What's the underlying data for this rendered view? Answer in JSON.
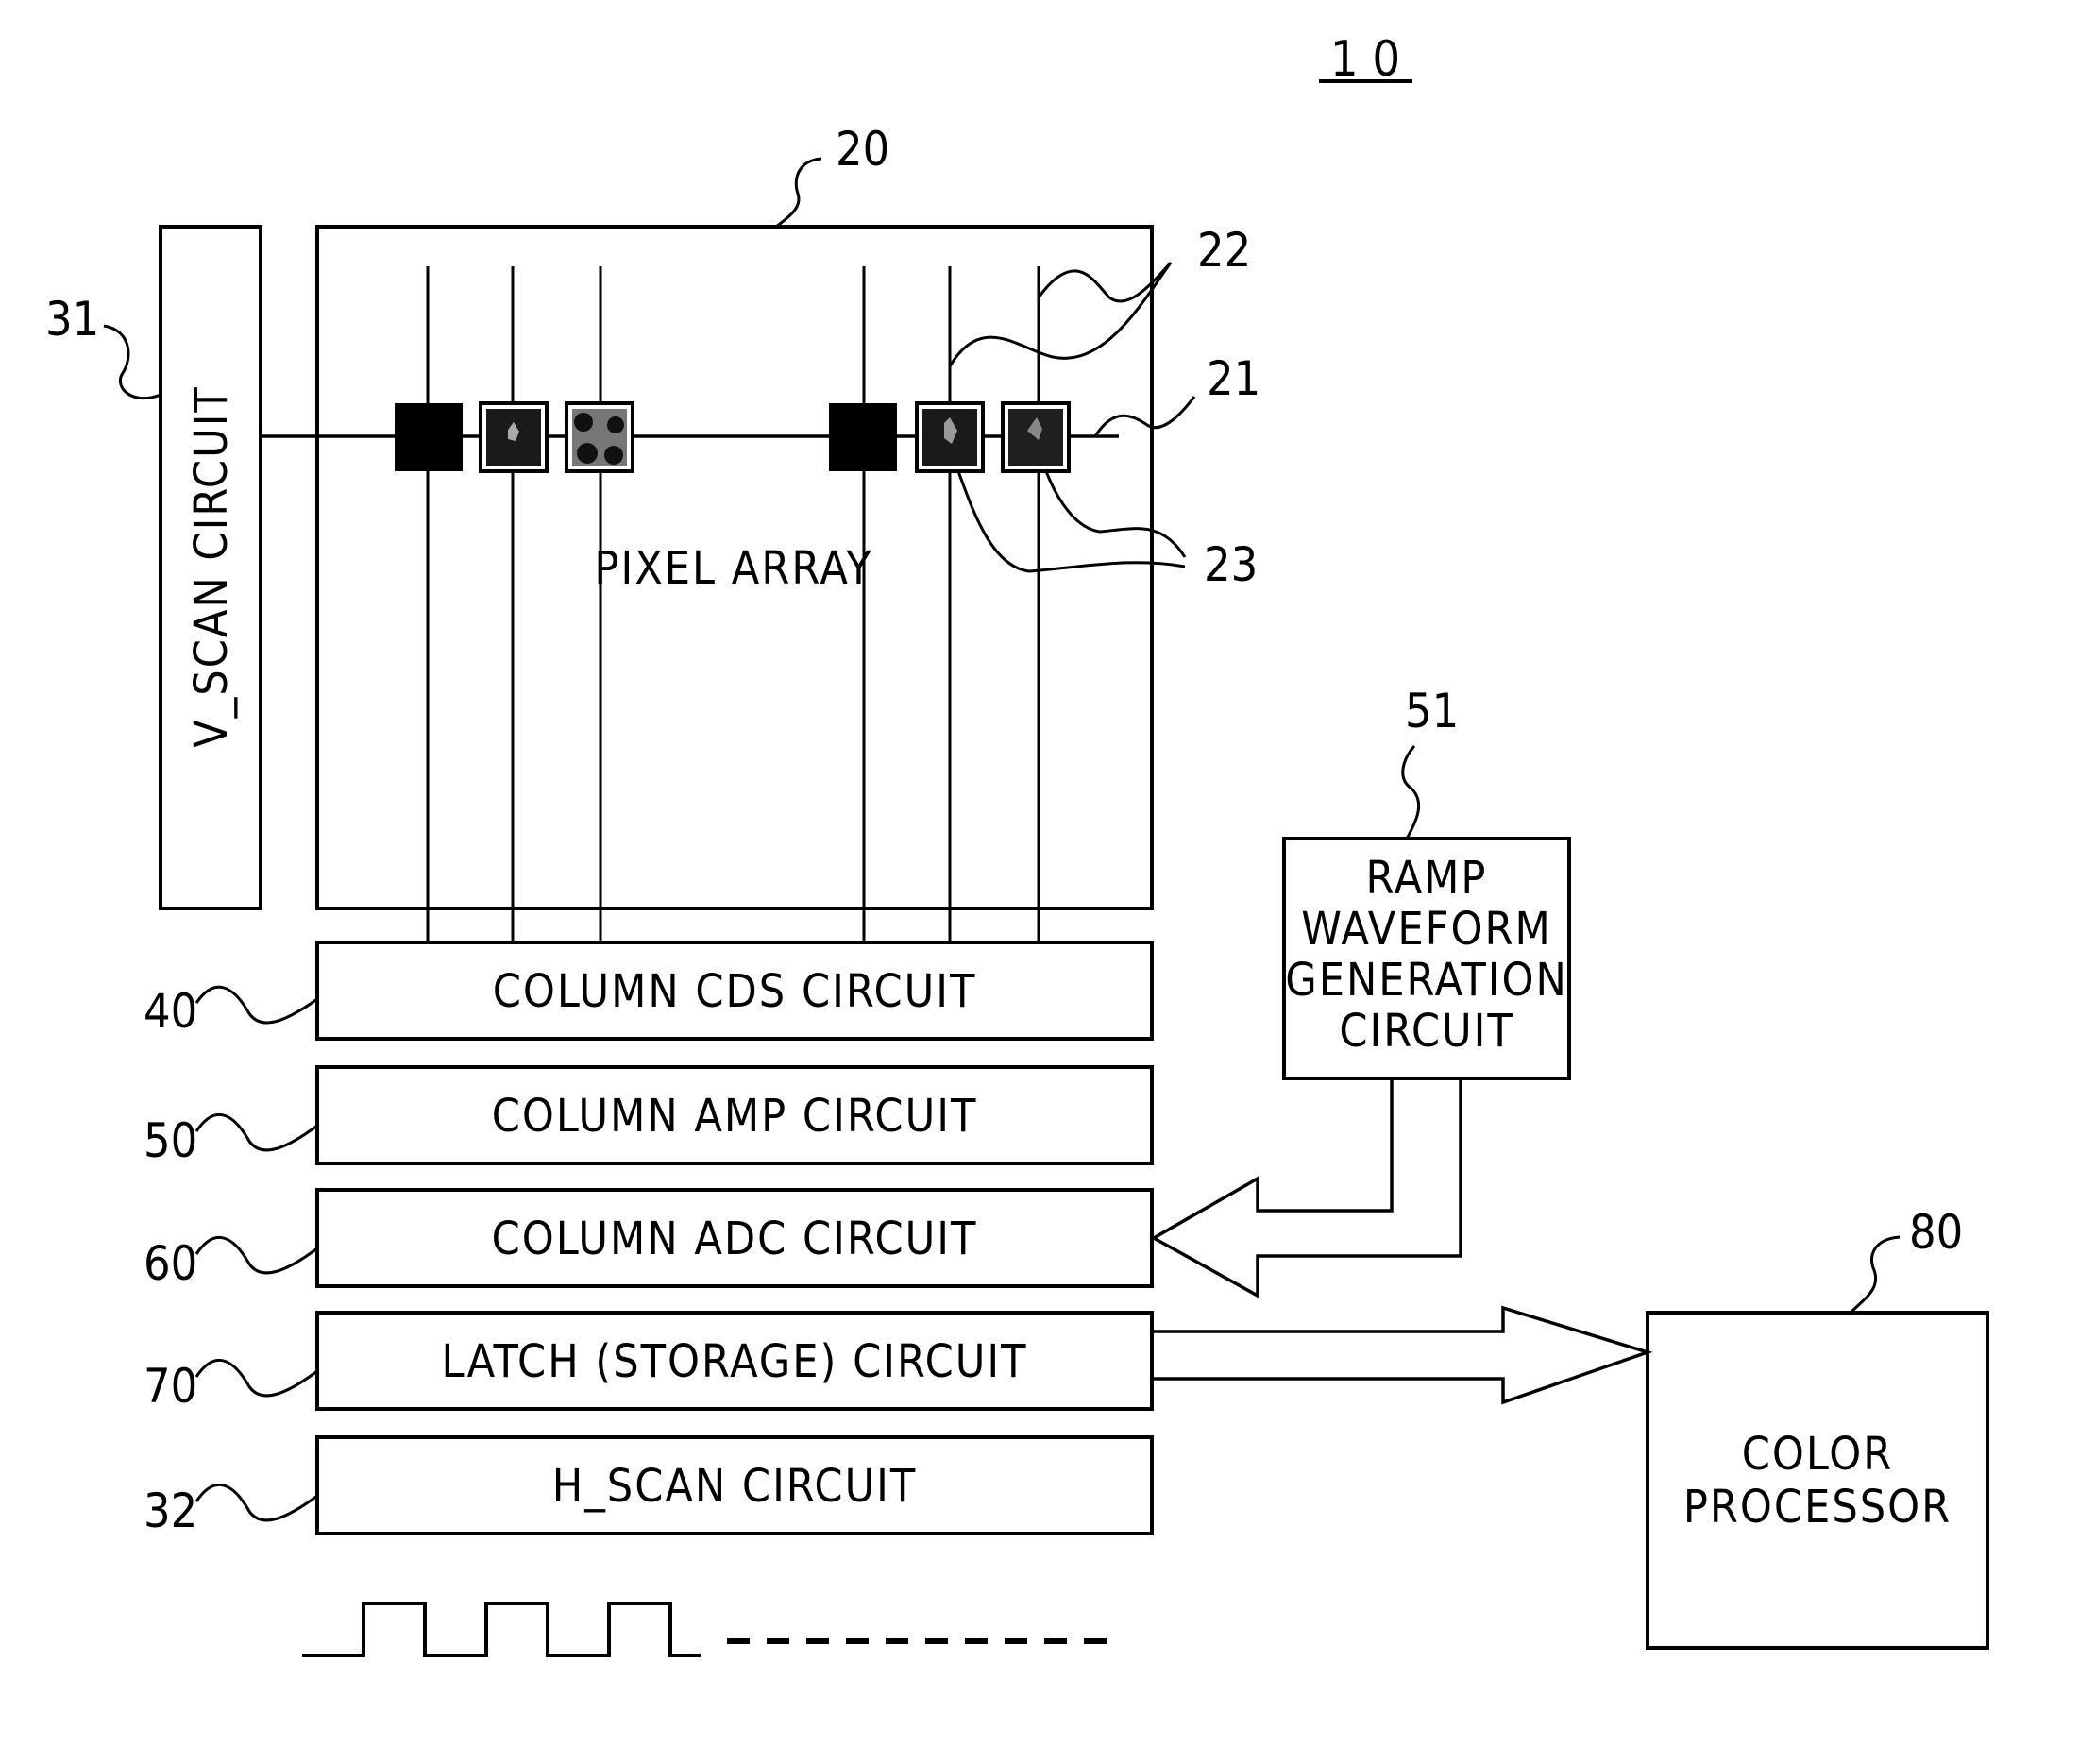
{
  "figure": {
    "number": "1 0",
    "colors": {
      "ink": "#000000",
      "paper": "#ffffff",
      "pixel_dark": "#111111",
      "pixel_mid": "#555555"
    }
  },
  "blocks": {
    "v_scan": {
      "ref": "31",
      "label": "V_SCAN CIRCUIT"
    },
    "pixel_array": {
      "ref": "20",
      "label": "PIXEL ARRAY",
      "row_line_ref": "21",
      "column_line_ref": "22",
      "pixel_ref": "23"
    },
    "cds": {
      "ref": "40",
      "label": "COLUMN CDS CIRCUIT"
    },
    "amp": {
      "ref": "50",
      "label": "COLUMN AMP CIRCUIT"
    },
    "adc": {
      "ref": "60",
      "label": "COLUMN ADC CIRCUIT"
    },
    "latch": {
      "ref": "70",
      "label": "LATCH (STORAGE) CIRCUIT"
    },
    "h_scan": {
      "ref": "32",
      "label": "H_SCAN CIRCUIT"
    },
    "ramp": {
      "ref": "51",
      "lines": [
        "RAMP",
        "WAVEFORM",
        "GENERATION",
        "CIRCUIT"
      ]
    },
    "color_processor": {
      "ref": "80",
      "lines": [
        "COLOR",
        "PROCESSOR"
      ]
    }
  },
  "clock_signal": {
    "pulses": 3,
    "continuation": "dashed"
  }
}
